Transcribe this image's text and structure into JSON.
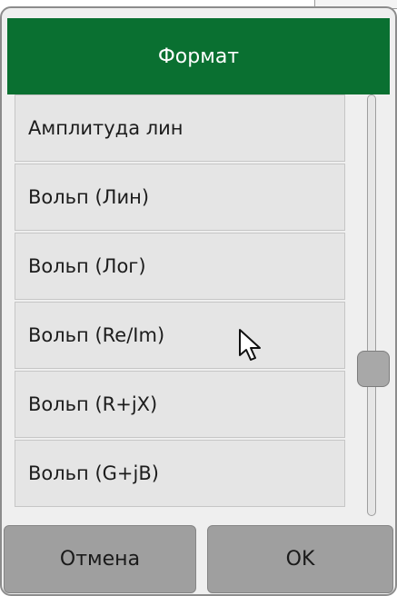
{
  "dialog": {
    "title": "Формат",
    "items": [
      {
        "label": "Амплитуда лин"
      },
      {
        "label": "Вольп (Лин)"
      },
      {
        "label": "Вольп (Лог)"
      },
      {
        "label": "Вольп (Re/Im)"
      },
      {
        "label": "Вольп (R+jX)"
      },
      {
        "label": "Вольп (G+jB)"
      }
    ],
    "scroll_position": 0.67,
    "cancel_label": "Отмена",
    "ok_label": "OK"
  },
  "colors": {
    "title_bar": "#0a7031",
    "title_text": "#ffffff",
    "button": "#9f9f9f"
  },
  "icons": {
    "cursor": "arrow-pointer-icon"
  }
}
